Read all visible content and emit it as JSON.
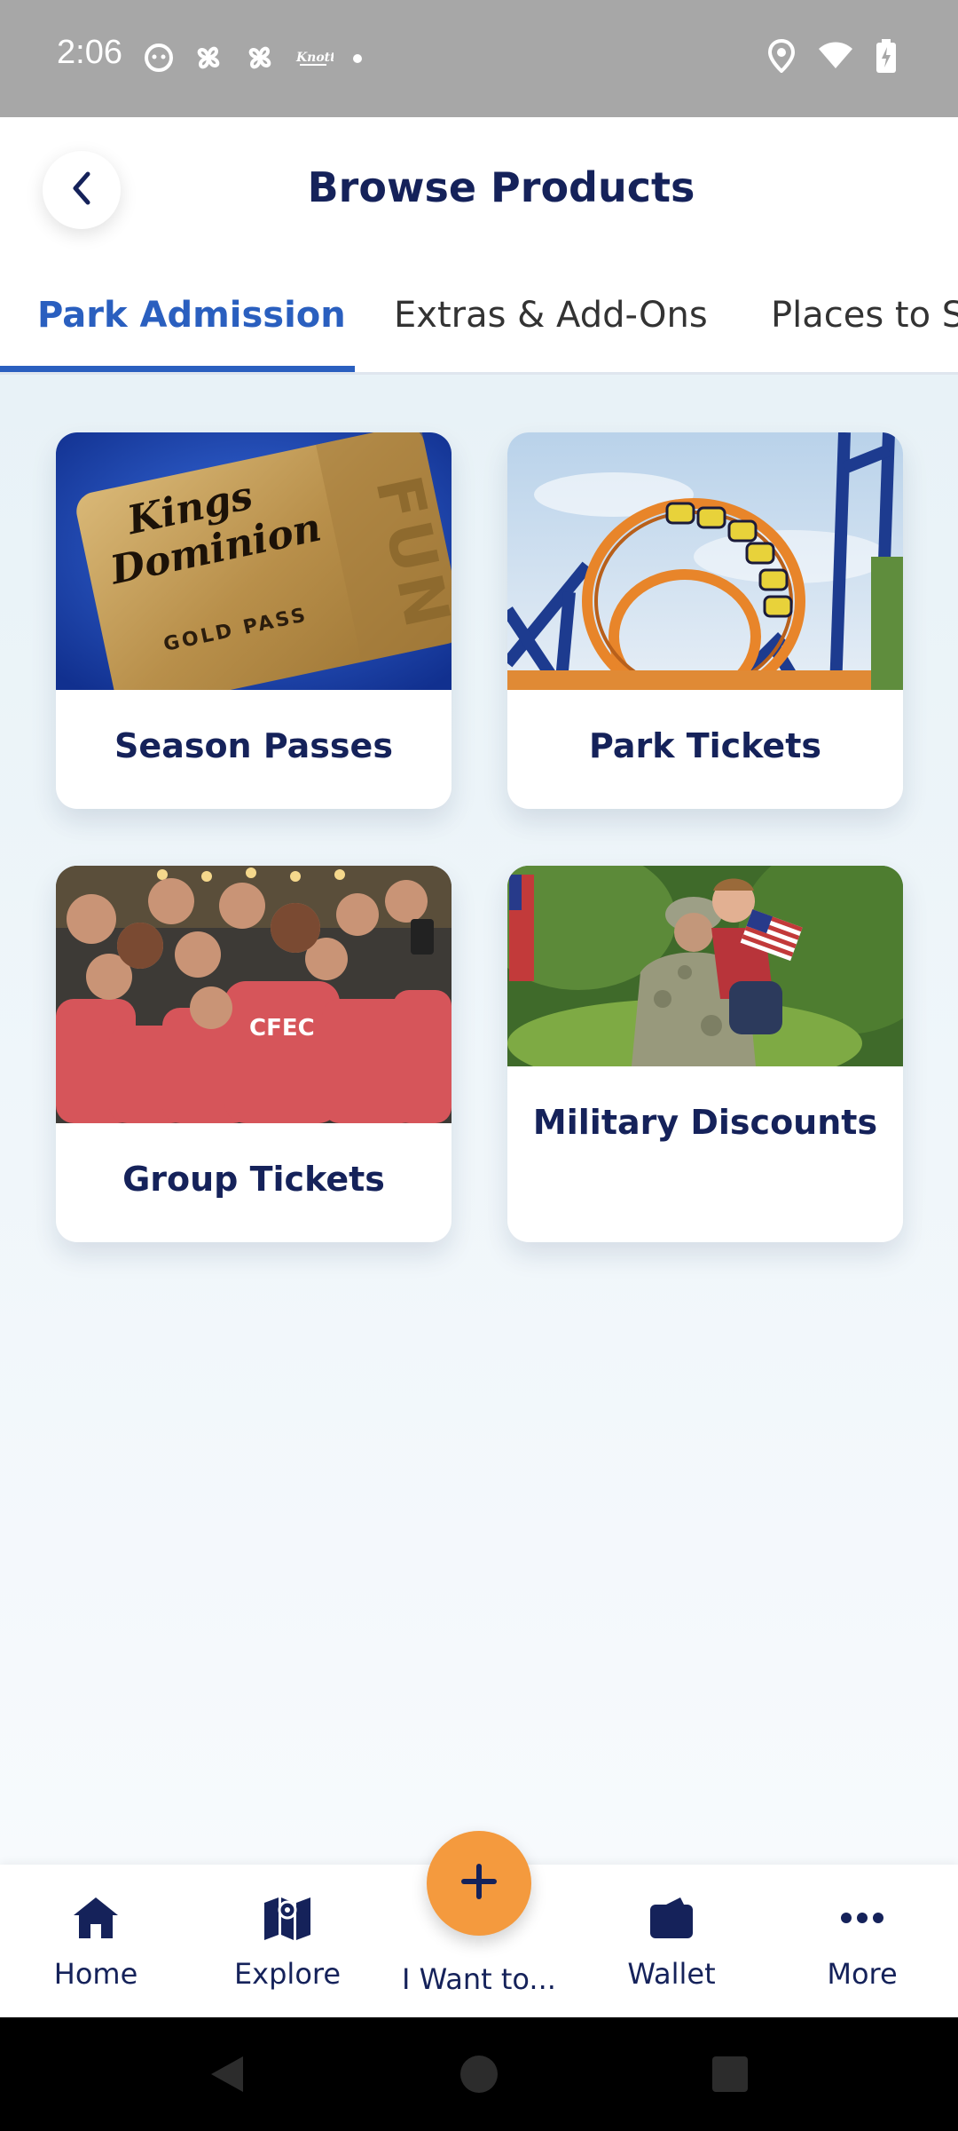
{
  "status_bar": {
    "time": "2:06",
    "left_icons": [
      "face-icon",
      "pinwheel-icon",
      "pinwheel-icon",
      "knotts-logo-icon",
      "dot-icon"
    ],
    "right_icons": [
      "location-icon",
      "wifi-icon",
      "battery-charging-icon"
    ]
  },
  "header": {
    "title": "Browse Products",
    "back_icon": "chevron-left-icon"
  },
  "tabs": [
    {
      "label": "Park Admission",
      "active": true
    },
    {
      "label": "Extras & Add-Ons",
      "active": false
    },
    {
      "label": "Places to St",
      "active": false
    }
  ],
  "cards": [
    {
      "label": "Season Passes",
      "image_text": {
        "brand_line1": "Kings",
        "brand_line2": "Dominion",
        "pass": "GOLD PASS",
        "badge": "FUN"
      }
    },
    {
      "label": "Park Tickets"
    },
    {
      "label": "Group Tickets",
      "image_text": {
        "shirt": "CFEC"
      }
    },
    {
      "label": "Military Discounts"
    }
  ],
  "bottom_nav": {
    "items": [
      {
        "label": "Home",
        "icon": "home-icon"
      },
      {
        "label": "Explore",
        "icon": "map-icon"
      },
      {
        "label": "Wallet",
        "icon": "wallet-icon"
      },
      {
        "label": "More",
        "icon": "more-dots-icon"
      }
    ],
    "fab": {
      "label": "I Want to...",
      "icon": "plus-icon"
    }
  },
  "colors": {
    "navy": "#15225a",
    "accent_blue": "#2a5fbf",
    "orange": "#f49a3e"
  }
}
